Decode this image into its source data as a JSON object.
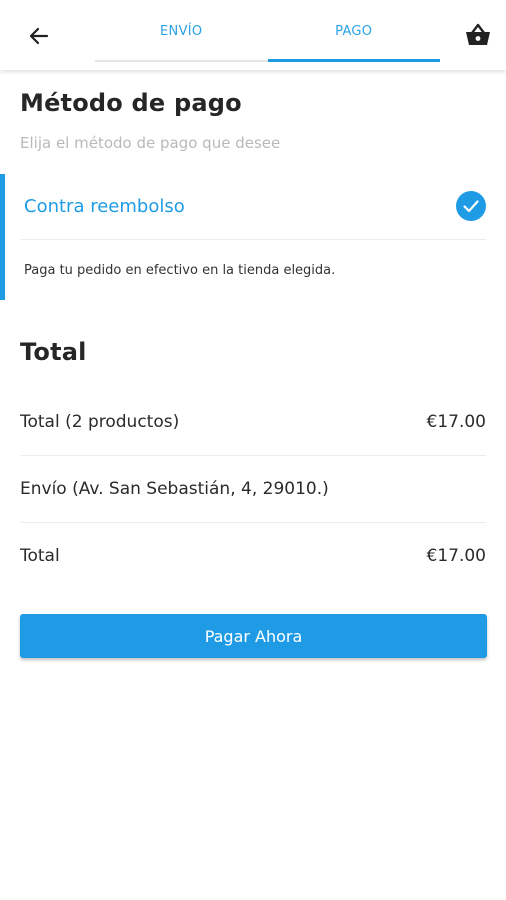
{
  "tabs": [
    {
      "label": "ENVÍO",
      "active": false
    },
    {
      "label": "PAGO",
      "active": true
    }
  ],
  "payment": {
    "title": "Método de pago",
    "subtitle": "Elija el método de pago que desee",
    "selected_method": "Contra reembolso",
    "description": "Paga tu pedido en efectivo en la tienda elegida.",
    "selected": true
  },
  "summary": {
    "title": "Total",
    "rows": [
      {
        "label": "Total (2 productos)",
        "value": "€17.00"
      },
      {
        "label": "Envío (Av. San Sebastián, 4, 29010.)",
        "value": ""
      },
      {
        "label": "Total",
        "value": "€17.00"
      }
    ]
  },
  "pay_button_label": "Pagar Ahora",
  "colors": {
    "accent": "#1f9be6",
    "tab_text": "#2aa3e8",
    "muted": "#b9b9b9"
  },
  "icons": {
    "back": "arrow-left-icon",
    "cart": "basket-icon",
    "check": "check-circle-icon"
  }
}
